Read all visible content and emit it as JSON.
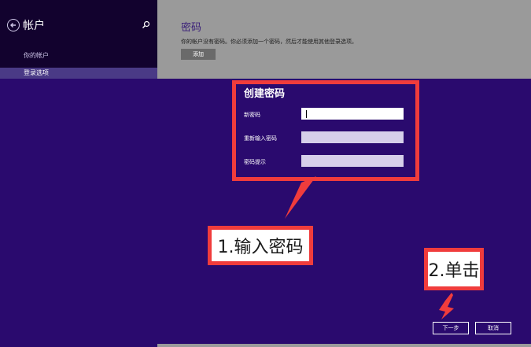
{
  "left_pane": {
    "title": "帐户",
    "nav_items": [
      {
        "label": "你的帐户"
      },
      {
        "label": "登录选项"
      }
    ]
  },
  "right_pane": {
    "title": "密码",
    "description": "你的帐户没有密码。你必须添加一个密码，然后才能使用其他登录选项。",
    "add_label": "添加"
  },
  "dialog": {
    "title": "创建密码",
    "fields": [
      {
        "label": "新密码",
        "value": ""
      },
      {
        "label": "重新输入密码",
        "value": ""
      },
      {
        "label": "密码提示",
        "value": ""
      }
    ]
  },
  "annotations": {
    "step1": "1.输入密码",
    "step2": "2.单击",
    "color": "#f03c3c"
  },
  "footer": {
    "next_label": "下一步",
    "cancel_label": "取消"
  },
  "colors": {
    "background": "#2a0a6e",
    "left_pane": "#12022e",
    "right_pane": "#9a9a9a"
  }
}
